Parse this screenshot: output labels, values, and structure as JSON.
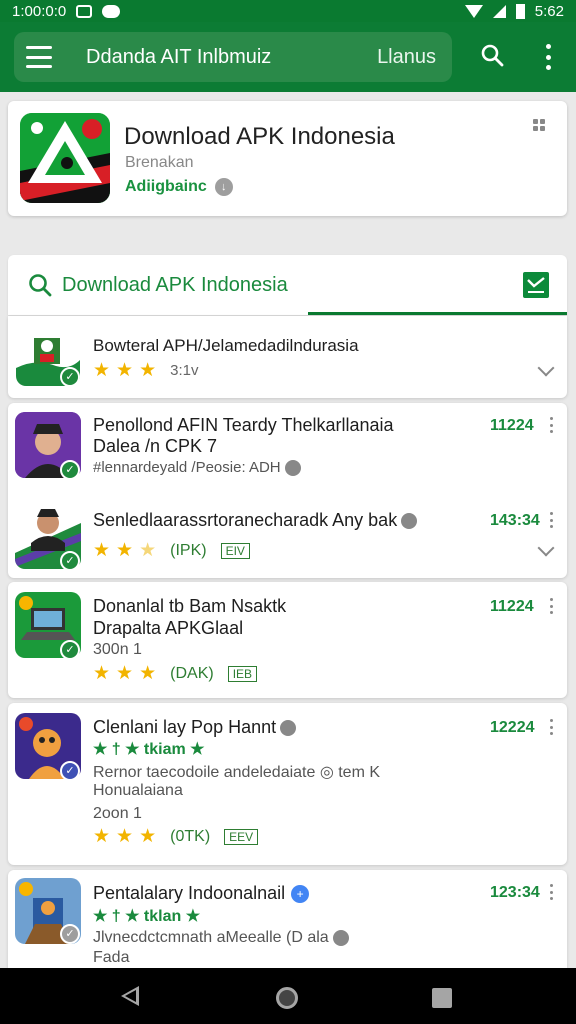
{
  "status_bar": {
    "time": "1:00:0:0",
    "clock_right": "5:62"
  },
  "app_bar": {
    "title": "Ddanda AIT Inlbmuiz",
    "action_label": "Llanus"
  },
  "header_app": {
    "name": "Download APK Indonesia",
    "category": "Brenakan",
    "developer": "Adiigbainc"
  },
  "search_tab": {
    "label": "Download APK Indonesia"
  },
  "apps": [
    {
      "title": "Bowteral APH/Jelamedadilndurasia",
      "rating_text": "3:1v",
      "stars": 3
    },
    {
      "title": "Penollond AFIN Teardy Thelkarllanaia",
      "title2": "Dalea /n CPK 7",
      "subtitle": "#lennardeyald /Peosie: ADH",
      "number": "11224"
    },
    {
      "title": "Senledlaarassrtoranecharadk Any bak",
      "number": "143:34",
      "rating_text": "(IPK)",
      "tag": "EIV",
      "stars": 2.5
    },
    {
      "title": "Donanlal tb Bam Nsaktk",
      "title2": "Drapalta APKGlaal",
      "subtitle": "300n 1",
      "number": "11224",
      "rating_text": "(DAK)",
      "tag": "IEB",
      "stars": 3
    },
    {
      "title": "Clenlani lay Pop Hannt",
      "green_rating": "★ † ★ tkiam ★",
      "subtitle": "Rernor taecodoile andeledaiate ◎ tem K",
      "subtitle2": "Honualaiana",
      "subtitle3": "2oon 1",
      "number": "12224",
      "rating_text": "(0TK)",
      "tag": "EEV",
      "stars": 3
    },
    {
      "title": "Pentalalary Indoonalnail",
      "green_rating": "★ † ★ tklan ★",
      "subtitle": "Jlvnecdctcmnath aMeealle (D ala",
      "subtitle2": "Fada",
      "number": "123:34"
    }
  ],
  "colors": {
    "primary": "#0c7c34",
    "accent": "#1a8a3d",
    "star": "#f2b400"
  }
}
